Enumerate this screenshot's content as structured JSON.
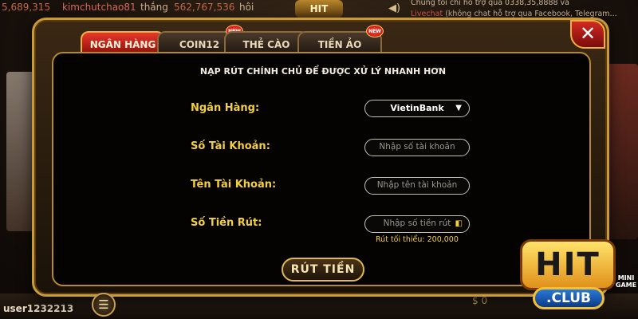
{
  "ticker": {
    "amount1": "5,689,315",
    "user": "kimchutchao81",
    "won_word": "thắng",
    "amount2": "562,767,536",
    "game": "hôi"
  },
  "top_logo": "HIT",
  "support": {
    "line1": "Chúng tôi chỉ hỗ trợ qua 0338,35,8888 và",
    "line2_link": "Livechat",
    "line2_rest": " (không chat hỗ trợ qua Facebook, Telegram..."
  },
  "tabs": [
    {
      "label": "NGÂN HÀNG",
      "active": true,
      "new": false
    },
    {
      "label": "COIN12",
      "active": false,
      "new": true
    },
    {
      "label": "THẺ CÀO",
      "active": false,
      "new": false
    },
    {
      "label": "TIỀN ẢO",
      "active": false,
      "new": true
    }
  ],
  "new_badge": "NEW",
  "notice": "NẠP RÚT CHÍNH CHỦ ĐỂ ĐƯỢC XỬ LÝ NHANH HƠN",
  "form": {
    "bank": {
      "label": "Ngân Hàng:",
      "value": "VietinBank"
    },
    "account_number": {
      "label": "Số Tài Khoản:",
      "placeholder": "Nhập số tài  khoản"
    },
    "account_name": {
      "label": "Tên Tài Khoản:",
      "placeholder": "Nhập tên tài khoản"
    },
    "amount": {
      "label": "Số Tiền Rút:",
      "placeholder": "Nhập số tiền rút"
    },
    "minimum": "Rút tối thiểu: 200,000"
  },
  "withdraw_button": "RÚT TIỀN",
  "user": "user1232213",
  "logo": {
    "hit": "HIT",
    "club": ".CLUB"
  },
  "minigame": "MINI GAME",
  "bottom_coin": "0",
  "bottom_coin2": "0",
  "icons": {
    "close": "close-icon",
    "caret": "chevron-down-icon",
    "wallet": "wallet-icon",
    "menu": "menu-icon",
    "sound": "sound-icon"
  },
  "colors": {
    "accent_red": "#d22a22",
    "gold": "#f2cf3e",
    "border_gold": "#c89a3a"
  }
}
